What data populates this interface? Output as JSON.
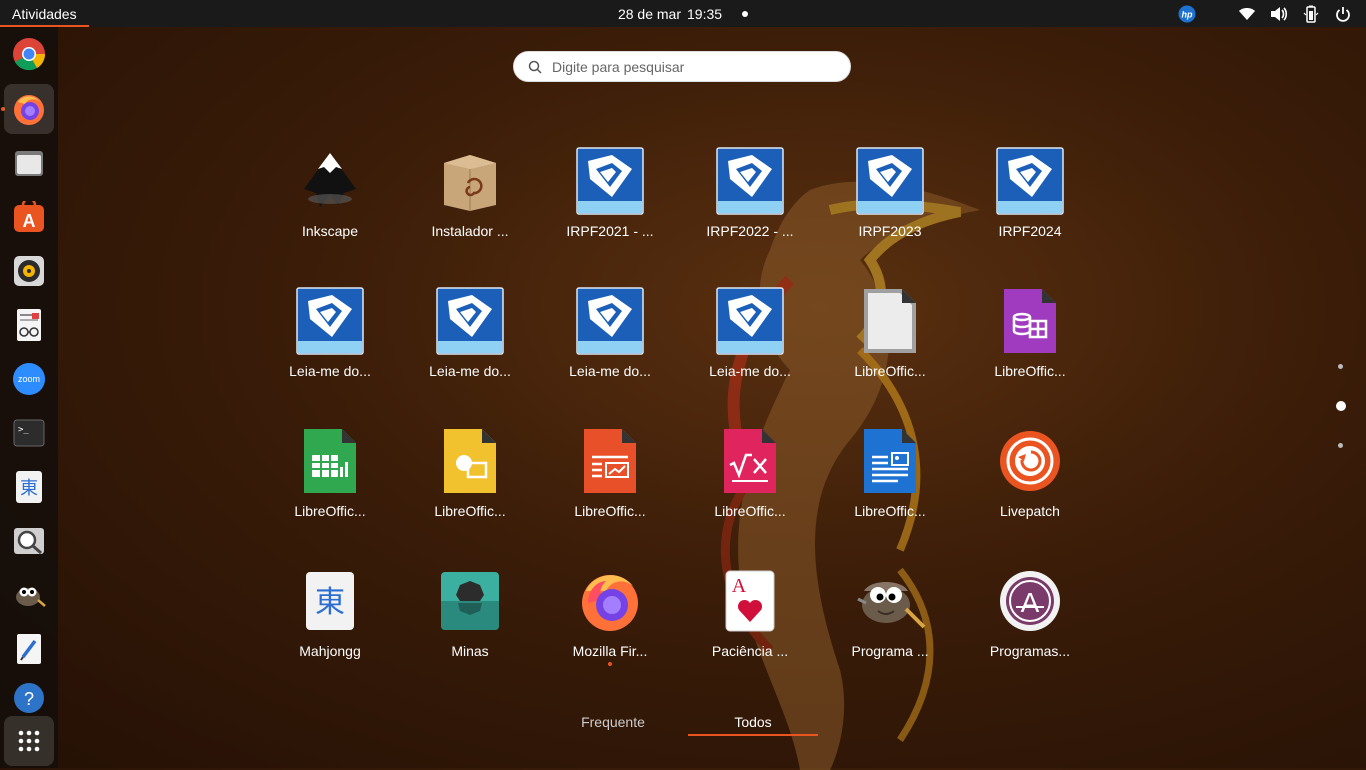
{
  "topbar": {
    "activities": "Atividades",
    "date": "28 de mar",
    "time": "19:35"
  },
  "tray_icons": [
    "hp-logo-icon",
    "wifi-icon",
    "volume-icon",
    "battery-icon",
    "power-icon"
  ],
  "dock": {
    "items": [
      {
        "name": "chrome",
        "icon": "chrome-icon"
      },
      {
        "name": "firefox",
        "icon": "firefox-icon",
        "active": true,
        "running": true
      },
      {
        "name": "files",
        "icon": "files-icon"
      },
      {
        "name": "app-center",
        "icon": "app-center-icon"
      },
      {
        "name": "rhythmbox",
        "icon": "rhythmbox-icon"
      },
      {
        "name": "document-viewer",
        "icon": "document-viewer-icon"
      },
      {
        "name": "zoom",
        "icon": "zoom-icon",
        "text": "zoom"
      },
      {
        "name": "terminal",
        "icon": "terminal-icon",
        "text": ">_"
      },
      {
        "name": "mahjongg",
        "icon": "mahjongg-icon",
        "text": "東"
      },
      {
        "name": "image-viewer",
        "icon": "magnifier-icon"
      },
      {
        "name": "gimp",
        "icon": "gimp-icon"
      },
      {
        "name": "text-editor",
        "icon": "text-editor-icon"
      },
      {
        "name": "help",
        "icon": "help-icon",
        "text": "?"
      }
    ]
  },
  "search": {
    "placeholder": "Digite para pesquisar"
  },
  "apps": [
    {
      "label": "Inkscape",
      "icon": "inkscape-icon"
    },
    {
      "label": "Instalador ...",
      "icon": "package-installer-icon"
    },
    {
      "label": "IRPF2021 - ...",
      "icon": "irpf-icon"
    },
    {
      "label": "IRPF2022 - ...",
      "icon": "irpf-icon"
    },
    {
      "label": "IRPF2023",
      "icon": "irpf-icon"
    },
    {
      "label": "IRPF2024",
      "icon": "irpf-icon"
    },
    {
      "label": "Leia-me do...",
      "icon": "irpf-icon"
    },
    {
      "label": "Leia-me do...",
      "icon": "irpf-icon"
    },
    {
      "label": "Leia-me do...",
      "icon": "irpf-icon"
    },
    {
      "label": "Leia-me do...",
      "icon": "irpf-icon"
    },
    {
      "label": "LibreOffic...",
      "icon": "libreoffice-icon"
    },
    {
      "label": "LibreOffic...",
      "icon": "libreoffice-base-icon"
    },
    {
      "label": "LibreOffic...",
      "icon": "libreoffice-calc-icon"
    },
    {
      "label": "LibreOffic...",
      "icon": "libreoffice-draw-icon"
    },
    {
      "label": "LibreOffic...",
      "icon": "libreoffice-impress-icon"
    },
    {
      "label": "LibreOffic...",
      "icon": "libreoffice-math-icon"
    },
    {
      "label": "LibreOffic...",
      "icon": "libreoffice-writer-icon"
    },
    {
      "label": "Livepatch",
      "icon": "livepatch-icon"
    },
    {
      "label": "Mahjongg",
      "icon": "mahjongg-icon"
    },
    {
      "label": "Minas",
      "icon": "mines-icon"
    },
    {
      "label": "Mozilla Fir...",
      "icon": "firefox-icon",
      "running": true
    },
    {
      "label": "Paciência ...",
      "icon": "solitaire-icon"
    },
    {
      "label": "Programa ...",
      "icon": "gimp-icon"
    },
    {
      "label": "Programas...",
      "icon": "app-center-icon"
    }
  ],
  "pager": {
    "pages": 3,
    "current": 2
  },
  "tabs": {
    "frequent": "Frequente",
    "all": "Todos",
    "selected": "all"
  },
  "colors": {
    "accent": "#e95420",
    "topbar": "#1a1a1a",
    "irpf_blue": "#1b5fb8",
    "base_purple": "#a03bc0",
    "calc_green": "#2fa84f",
    "draw_yellow": "#f2c12e",
    "impress_orange": "#e8502a",
    "math_pink": "#e0245e",
    "writer_blue": "#1e73d2"
  }
}
